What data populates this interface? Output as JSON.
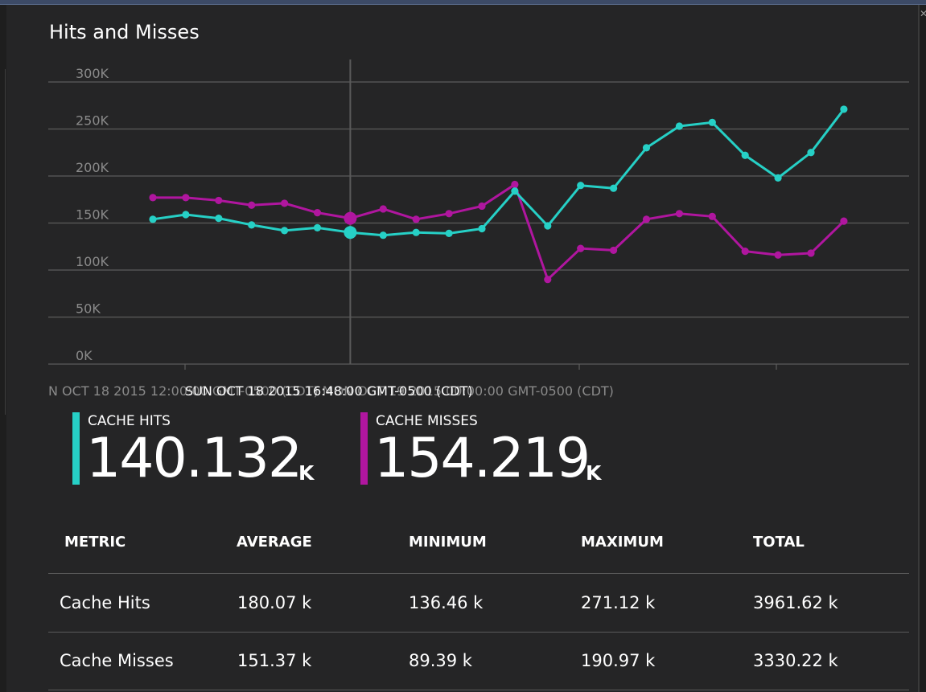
{
  "title": "Hits and Misses",
  "colors": {
    "hits": "#26d0c6",
    "misses": "#b0169f",
    "grid": "#5c5c5c",
    "background": "#252526"
  },
  "chart_data": {
    "type": "line",
    "ylim": [
      0,
      300000
    ],
    "yticks": [
      "300K",
      "250K",
      "200K",
      "150K",
      "100K",
      "50K",
      "0K"
    ],
    "grid": true,
    "x_axis_caption": "N OCT 18 2015 12:00:00 GMT-0500 (CDT)        MON OCT 19 2015 00:00:00 GMT-0500 (CDT)",
    "hover_caption": "SUN OCT 18 2015 16:48:00 GMT-0500 (CDT)",
    "hover_index": 6,
    "series": [
      {
        "name": "CACHE HITS",
        "color": "#26d0c6",
        "values": [
          154000,
          159000,
          155000,
          148000,
          142000,
          145000,
          140000,
          137000,
          140000,
          139000,
          144000,
          184000,
          147000,
          190000,
          187000,
          230000,
          253000,
          257000,
          222000,
          198000,
          225000,
          271000
        ]
      },
      {
        "name": "CACHE MISSES",
        "color": "#b0169f",
        "values": [
          177000,
          177000,
          174000,
          169000,
          171000,
          161000,
          155000,
          165000,
          154000,
          160000,
          168000,
          191000,
          90000,
          123000,
          121000,
          154000,
          160000,
          157000,
          120000,
          116000,
          118000,
          152000
        ]
      }
    ]
  },
  "summary": {
    "hits": {
      "label": "CACHE HITS",
      "value": "140.132",
      "unit": "K"
    },
    "misses": {
      "label": "CACHE MISSES",
      "value": "154.219",
      "unit": "K"
    }
  },
  "table": {
    "headers": [
      "METRIC",
      "AVERAGE",
      "MINIMUM",
      "MAXIMUM",
      "TOTAL"
    ],
    "rows": [
      [
        "Cache Hits",
        "180.07 k",
        "136.46 k",
        "271.12 k",
        "3961.62 k"
      ],
      [
        "Cache Misses",
        "151.37 k",
        "89.39 k",
        "190.97 k",
        "3330.22 k"
      ]
    ]
  }
}
